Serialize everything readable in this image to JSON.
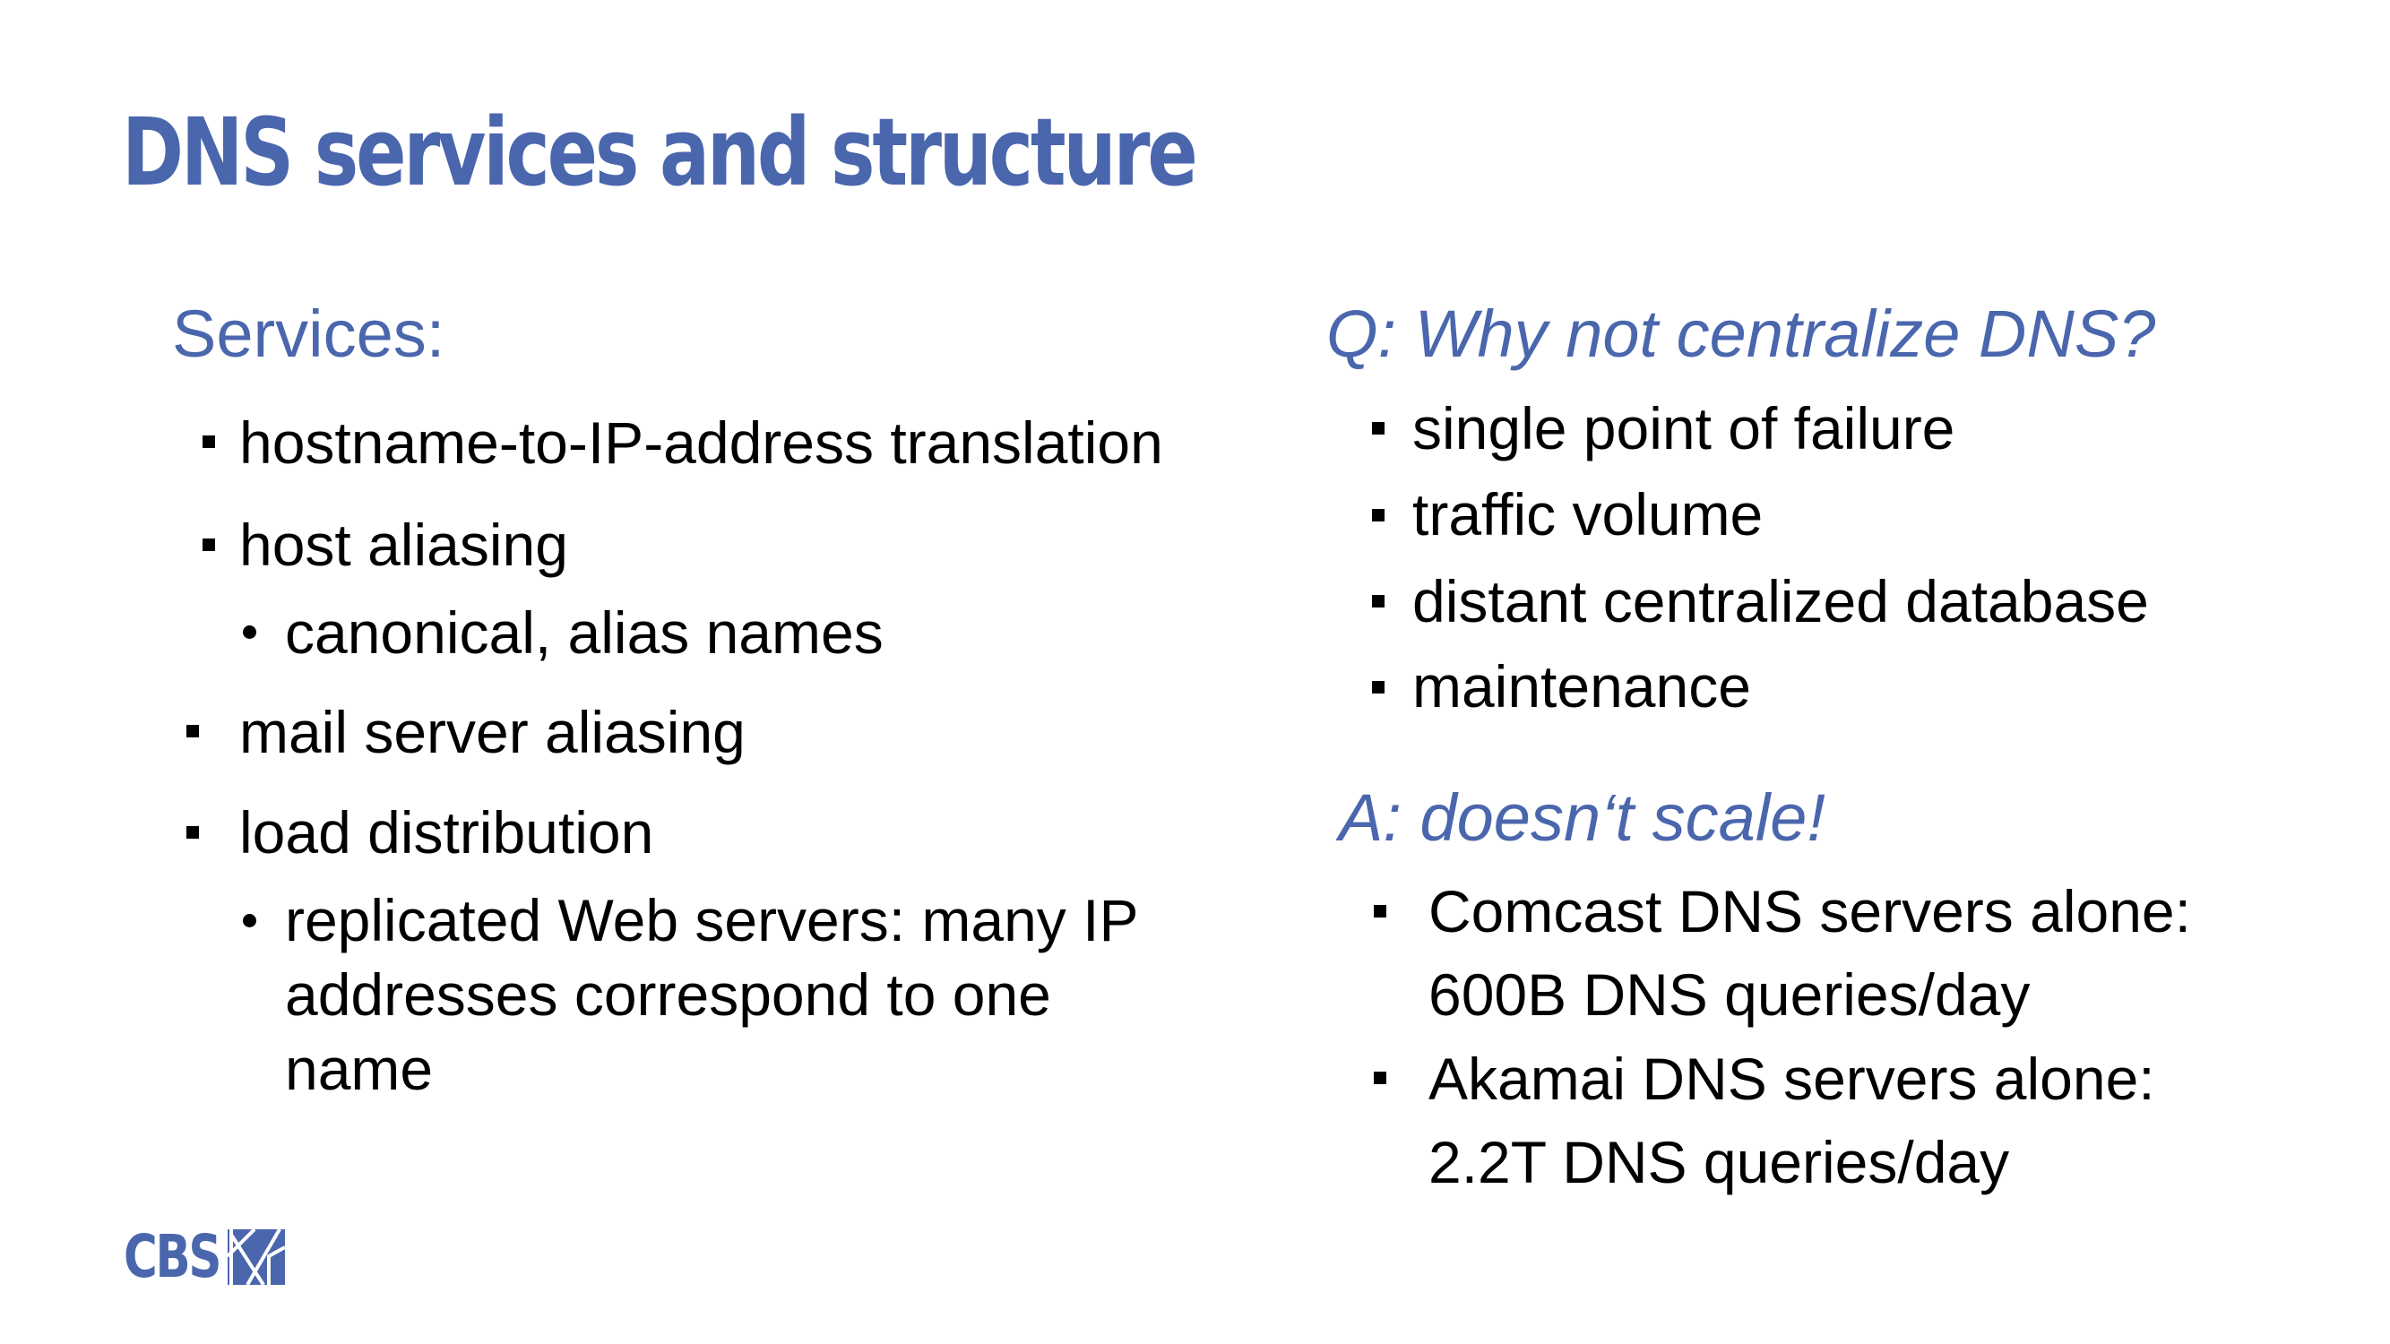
{
  "colors": {
    "accent": "#4a66ad",
    "text": "#000000",
    "background": "#ffffff"
  },
  "slide": {
    "title": "DNS services and structure"
  },
  "left": {
    "heading": "Services:",
    "items": [
      "hostname-to-IP-address translation",
      "host aliasing",
      "canonical, alias names",
      "mail server aliasing",
      "load distribution",
      "replicated Web servers: many IP",
      "addresses correspond to one",
      "name"
    ]
  },
  "right": {
    "question": "Q: Why not centralize DNS?",
    "reasons": [
      "single point of failure",
      "traffic volume",
      "distant centralized database",
      "maintenance"
    ],
    "answer": "A: doesn‘t scale!",
    "facts": [
      "Comcast DNS servers alone:",
      "600B DNS queries/day",
      "Akamai DNS servers alone:",
      "2.2T DNS queries/day"
    ]
  },
  "footer": {
    "logo_text": "CBS",
    "logo_icon": "cbs-logo-icon"
  }
}
